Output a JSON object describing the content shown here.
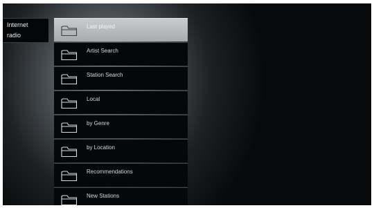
{
  "breadcrumb": {
    "line1": "Internet",
    "line2": "radio"
  },
  "menu": {
    "items": [
      {
        "label": "Last played",
        "selected": true
      },
      {
        "label": "Artist Search",
        "selected": false
      },
      {
        "label": "Station Search",
        "selected": false
      },
      {
        "label": "Local",
        "selected": false
      },
      {
        "label": "by Genre",
        "selected": false
      },
      {
        "label": "by Location",
        "selected": false
      },
      {
        "label": "Recommendations",
        "selected": false
      },
      {
        "label": "New Stations",
        "selected": false
      }
    ]
  },
  "icons": {
    "menu_item_icon": "folder-icon"
  }
}
